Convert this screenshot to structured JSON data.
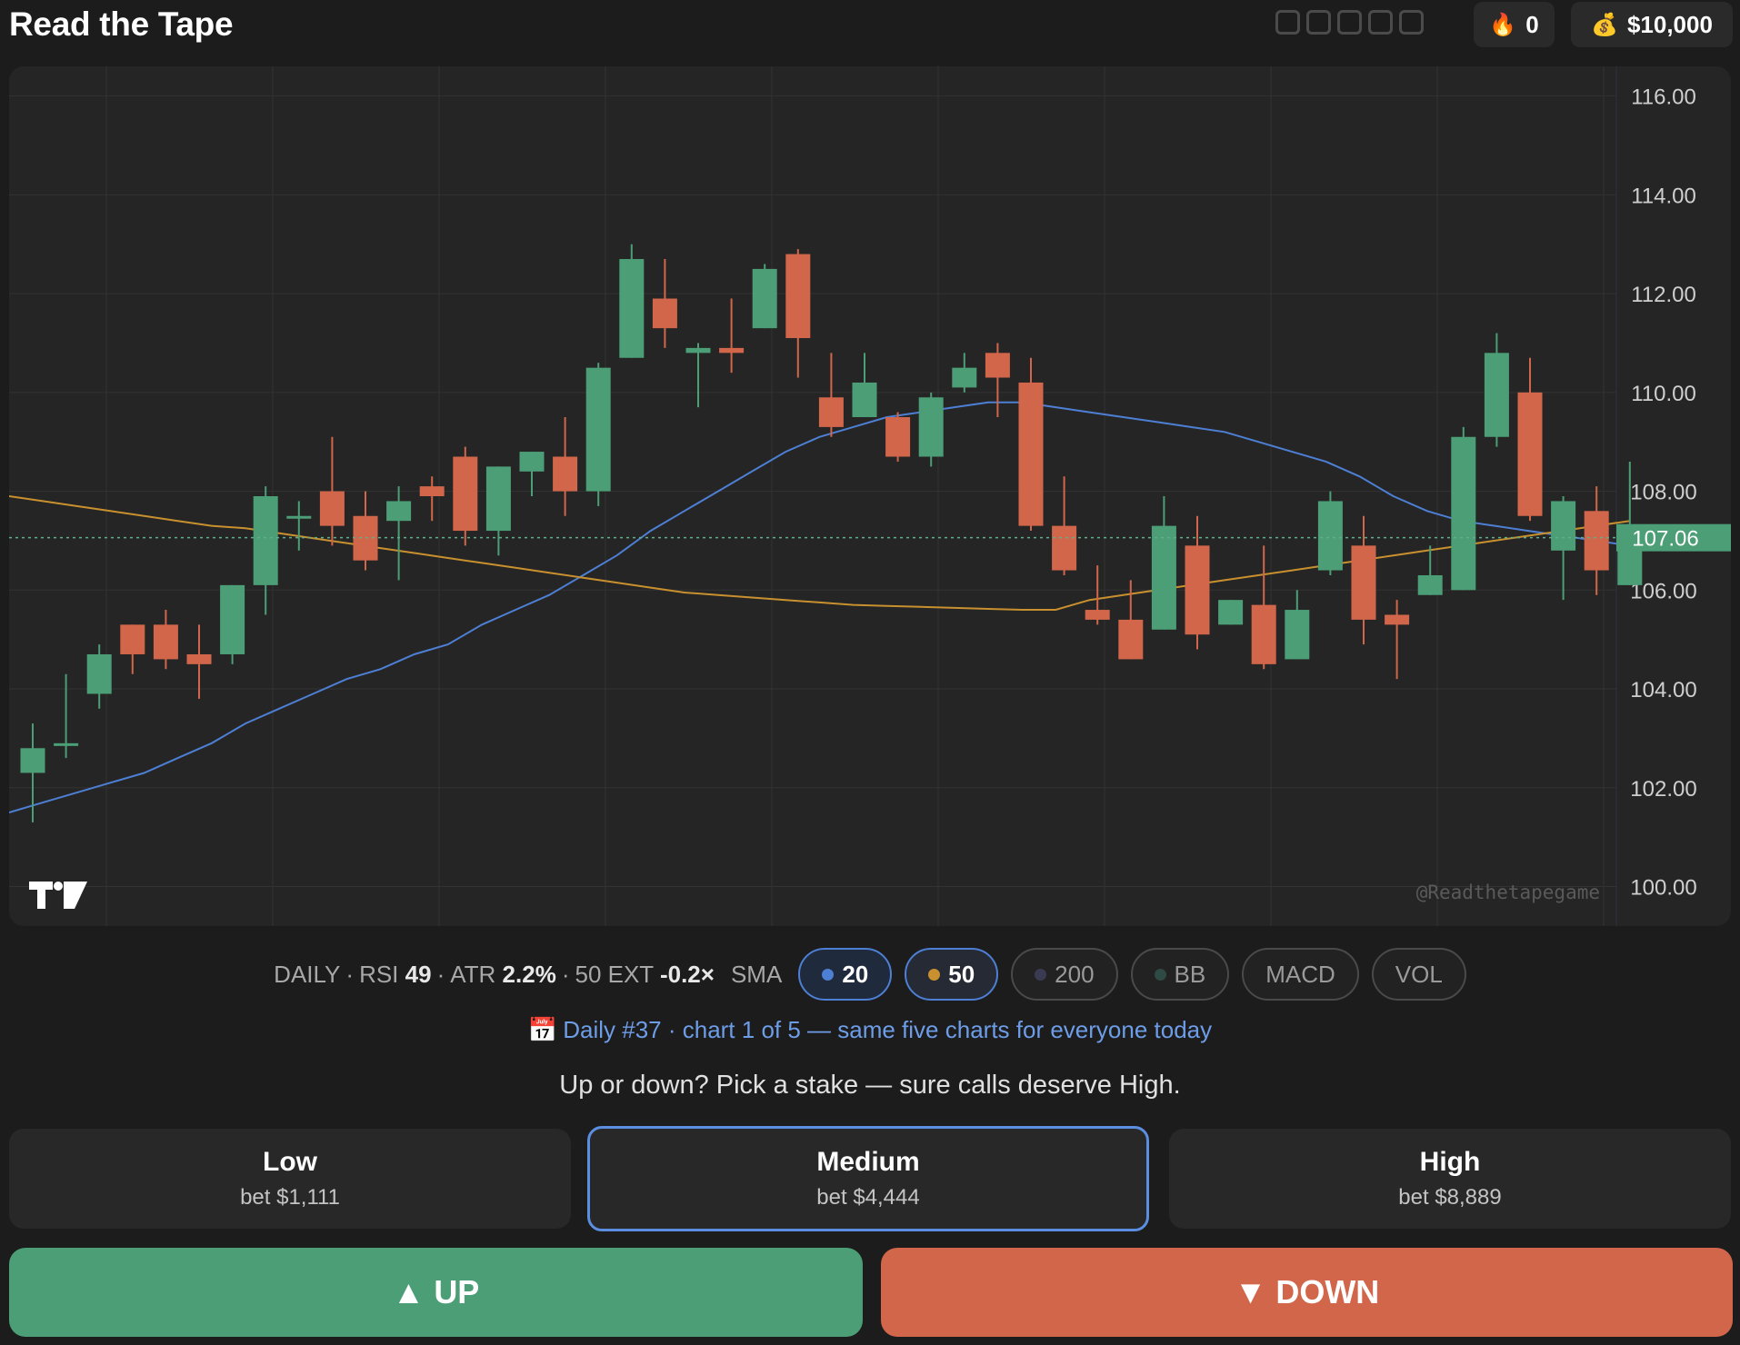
{
  "header": {
    "title": "Read the Tape",
    "progress_slots": 5,
    "streak": {
      "icon": "fire-icon",
      "value": "0"
    },
    "bankroll": {
      "icon": "money-bag-icon",
      "value": "$10,000"
    }
  },
  "chart": {
    "watermark": "@Readthetapegame",
    "logo": "TV",
    "current_price_label": "107.06",
    "colors": {
      "background": "#252525",
      "up": "#4c9e76",
      "down": "#d2664a",
      "sma20": "#4d7fd4",
      "sma50": "#c8902e",
      "grid": "#333333",
      "price_tag": "#4c9e76"
    }
  },
  "chart_data": {
    "type": "candlestick",
    "y_ticks": [
      "116.00",
      "114.00",
      "112.00",
      "110.00",
      "108.00",
      "106.00",
      "104.00",
      "102.00",
      "100.00"
    ],
    "ylim": [
      99.2,
      116.6
    ],
    "last_price": 107.06,
    "candles": [
      {
        "o": 102.3,
        "h": 103.3,
        "l": 101.3,
        "c": 102.8
      },
      {
        "o": 102.9,
        "h": 104.3,
        "l": 102.6,
        "c": 102.9
      },
      {
        "o": 103.9,
        "h": 104.9,
        "l": 103.6,
        "c": 104.7
      },
      {
        "o": 105.3,
        "h": 105.3,
        "l": 104.3,
        "c": 104.7
      },
      {
        "o": 105.3,
        "h": 105.6,
        "l": 104.4,
        "c": 104.6
      },
      {
        "o": 104.7,
        "h": 105.3,
        "l": 103.8,
        "c": 104.5
      },
      {
        "o": 104.7,
        "h": 106.1,
        "l": 104.5,
        "c": 106.1
      },
      {
        "o": 106.1,
        "h": 108.1,
        "l": 105.5,
        "c": 107.9
      },
      {
        "o": 107.5,
        "h": 107.8,
        "l": 106.8,
        "c": 107.5
      },
      {
        "o": 108.0,
        "h": 109.1,
        "l": 106.9,
        "c": 107.3
      },
      {
        "o": 107.5,
        "h": 108.0,
        "l": 106.4,
        "c": 106.6
      },
      {
        "o": 107.4,
        "h": 108.1,
        "l": 106.2,
        "c": 107.8
      },
      {
        "o": 108.1,
        "h": 108.3,
        "l": 107.4,
        "c": 107.9
      },
      {
        "o": 108.7,
        "h": 108.9,
        "l": 106.9,
        "c": 107.2
      },
      {
        "o": 107.2,
        "h": 108.5,
        "l": 106.7,
        "c": 108.5
      },
      {
        "o": 108.4,
        "h": 108.8,
        "l": 107.9,
        "c": 108.8
      },
      {
        "o": 108.7,
        "h": 109.5,
        "l": 107.5,
        "c": 108.0
      },
      {
        "o": 108.0,
        "h": 110.6,
        "l": 107.7,
        "c": 110.5
      },
      {
        "o": 110.7,
        "h": 113.0,
        "l": 110.7,
        "c": 112.7
      },
      {
        "o": 111.9,
        "h": 112.7,
        "l": 110.9,
        "c": 111.3
      },
      {
        "o": 110.8,
        "h": 111.0,
        "l": 109.7,
        "c": 110.9
      },
      {
        "o": 110.9,
        "h": 111.9,
        "l": 110.4,
        "c": 110.8
      },
      {
        "o": 111.3,
        "h": 112.6,
        "l": 111.3,
        "c": 112.5
      },
      {
        "o": 112.8,
        "h": 112.9,
        "l": 110.3,
        "c": 111.1
      },
      {
        "o": 109.9,
        "h": 110.8,
        "l": 109.1,
        "c": 109.3
      },
      {
        "o": 109.5,
        "h": 110.8,
        "l": 109.5,
        "c": 110.2
      },
      {
        "o": 109.5,
        "h": 109.6,
        "l": 108.6,
        "c": 108.7
      },
      {
        "o": 108.7,
        "h": 110.0,
        "l": 108.5,
        "c": 109.9
      },
      {
        "o": 110.1,
        "h": 110.8,
        "l": 110.0,
        "c": 110.5
      },
      {
        "o": 110.8,
        "h": 111.0,
        "l": 109.5,
        "c": 110.3
      },
      {
        "o": 110.2,
        "h": 110.7,
        "l": 107.2,
        "c": 107.3
      },
      {
        "o": 107.3,
        "h": 108.3,
        "l": 106.3,
        "c": 106.4
      },
      {
        "o": 105.6,
        "h": 106.5,
        "l": 105.3,
        "c": 105.4
      },
      {
        "o": 105.4,
        "h": 106.2,
        "l": 104.6,
        "c": 104.6
      },
      {
        "o": 105.2,
        "h": 107.9,
        "l": 105.2,
        "c": 107.3
      },
      {
        "o": 106.9,
        "h": 107.5,
        "l": 104.8,
        "c": 105.1
      },
      {
        "o": 105.3,
        "h": 105.8,
        "l": 105.3,
        "c": 105.8
      },
      {
        "o": 105.7,
        "h": 106.9,
        "l": 104.4,
        "c": 104.5
      },
      {
        "o": 104.6,
        "h": 106.0,
        "l": 104.6,
        "c": 105.6
      },
      {
        "o": 106.4,
        "h": 108.0,
        "l": 106.3,
        "c": 107.8
      },
      {
        "o": 106.9,
        "h": 107.5,
        "l": 104.9,
        "c": 105.4
      },
      {
        "o": 105.5,
        "h": 105.8,
        "l": 104.2,
        "c": 105.3
      },
      {
        "o": 105.9,
        "h": 106.9,
        "l": 105.9,
        "c": 106.3
      },
      {
        "o": 106.0,
        "h": 109.3,
        "l": 106.0,
        "c": 109.1
      },
      {
        "o": 109.1,
        "h": 111.2,
        "l": 108.9,
        "c": 110.8
      },
      {
        "o": 110.0,
        "h": 110.7,
        "l": 107.4,
        "c": 107.5
      },
      {
        "o": 106.8,
        "h": 107.9,
        "l": 105.8,
        "c": 107.8
      },
      {
        "o": 107.6,
        "h": 108.1,
        "l": 105.9,
        "c": 106.4
      },
      {
        "o": 106.1,
        "h": 108.6,
        "l": 106.1,
        "c": 107.0
      }
    ],
    "series": [
      {
        "name": "20",
        "values": [
          101.5,
          101.7,
          101.9,
          102.1,
          102.3,
          102.6,
          102.9,
          103.3,
          103.6,
          103.9,
          104.2,
          104.4,
          104.7,
          104.9,
          105.3,
          105.6,
          105.9,
          106.3,
          106.7,
          107.2,
          107.6,
          108.0,
          108.4,
          108.8,
          109.1,
          109.3,
          109.5,
          109.6,
          109.7,
          109.8,
          109.8,
          109.7,
          109.6,
          109.5,
          109.4,
          109.3,
          109.2,
          109.0,
          108.8,
          108.6,
          108.3,
          107.9,
          107.6,
          107.4,
          107.3,
          107.2,
          107.1,
          107.0,
          106.9
        ]
      },
      {
        "name": "50",
        "values": [
          107.9,
          107.8,
          107.7,
          107.6,
          107.5,
          107.4,
          107.3,
          107.25,
          107.15,
          107.05,
          106.95,
          106.85,
          106.75,
          106.65,
          106.55,
          106.45,
          106.35,
          106.25,
          106.15,
          106.05,
          105.95,
          105.9,
          105.85,
          105.8,
          105.75,
          105.7,
          105.68,
          105.66,
          105.64,
          105.62,
          105.6,
          105.6,
          105.8,
          105.9,
          106.0,
          106.1,
          106.2,
          106.3,
          106.4,
          106.5,
          106.6,
          106.7,
          106.8,
          106.9,
          107.0,
          107.1,
          107.2,
          107.3,
          107.4
        ]
      }
    ]
  },
  "stats": {
    "timeframe": "DAILY",
    "rsi_label": "RSI",
    "rsi_value": "49",
    "atr_label": "ATR",
    "atr_value": "2.2%",
    "ext_label": "50 EXT",
    "ext_value": "-0.2×",
    "sma_label": "SMA",
    "toggles": [
      {
        "label": "20",
        "dot_color": "#4d7fd4",
        "active": true
      },
      {
        "label": "50",
        "dot_color": "#c8902e",
        "active": true
      },
      {
        "label": "200",
        "dot_color": "#3a3a52",
        "active": false
      },
      {
        "label": "BB",
        "dot_color": "#2f4a44",
        "active": false
      },
      {
        "label": "MACD",
        "active": false
      },
      {
        "label": "VOL",
        "active": false
      }
    ]
  },
  "daily": {
    "icon": "calendar-icon",
    "text": "Daily #37 · chart 1 of 5 — same five charts for everyone today"
  },
  "prompt": "Up or down? Pick a stake — sure calls deserve High.",
  "stakes": [
    {
      "name": "Low",
      "bet": "bet $1,111",
      "selected": false
    },
    {
      "name": "Medium",
      "bet": "bet $4,444",
      "selected": true
    },
    {
      "name": "High",
      "bet": "bet $8,889",
      "selected": false
    }
  ],
  "actions": {
    "up_label": "UP",
    "down_label": "DOWN"
  }
}
